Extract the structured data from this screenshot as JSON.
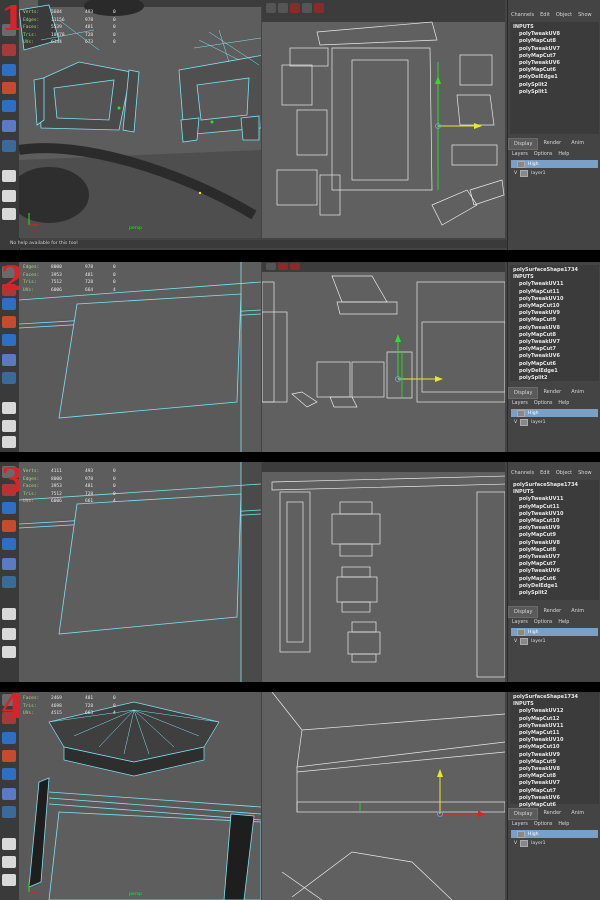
{
  "panels": [
    {
      "number": "1",
      "hud": [
        {
          "label": "Verts:",
          "a": "5684",
          "b": "493",
          "c": "0"
        },
        {
          "label": "Edges:",
          "a": "11156",
          "b": "978",
          "c": "0"
        },
        {
          "label": "Faces:",
          "a": "5539",
          "b": "481",
          "c": "0"
        },
        {
          "label": "Tris:",
          "a": "10478",
          "b": "728",
          "c": "0"
        },
        {
          "label": "UVs:",
          "a": "6144",
          "b": "673",
          "c": "0"
        }
      ],
      "tabs": [
        "Channels",
        "Edit",
        "Object",
        "Show"
      ],
      "node": "",
      "inputs_label": "INPUTS",
      "inputs": [
        "polyTweakUV8",
        "polyMapCut8",
        "polyTweakUV7",
        "polyMapCut7",
        "polyTweakUV6",
        "polyMapCut6",
        "polyDelEdge1",
        "polySplit2",
        "polySplit1"
      ],
      "camera": "persp",
      "status": "No help available for this tool"
    },
    {
      "number": "2",
      "hud": [
        {
          "label": "Edges:",
          "a": "8000",
          "b": "978",
          "c": "0"
        },
        {
          "label": "Faces:",
          "a": "3953",
          "b": "481",
          "c": "0"
        },
        {
          "label": "Tris:",
          "a": "7512",
          "b": "728",
          "c": "0"
        },
        {
          "label": "UVs:",
          "a": "6006",
          "b": "664",
          "c": "4"
        }
      ],
      "tabs": [],
      "node": "polySurfaceShape1734",
      "inputs_label": "INPUTS",
      "inputs": [
        "polyTweakUV11",
        "polyMapCut11",
        "polyTweakUV10",
        "polyMapCut10",
        "polyTweakUV9",
        "polyMapCut9",
        "polyTweakUV8",
        "polyMapCut8",
        "polyTweakUV7",
        "polyMapCut7",
        "polyTweakUV6",
        "polyMapCut6",
        "polyDelEdge1",
        "polySplit2"
      ],
      "camera": "",
      "status": ""
    },
    {
      "number": "3",
      "hud": [
        {
          "label": "Verts:",
          "a": "4111",
          "b": "493",
          "c": "0"
        },
        {
          "label": "Edges:",
          "a": "8000",
          "b": "978",
          "c": "0"
        },
        {
          "label": "Faces:",
          "a": "3953",
          "b": "481",
          "c": "0"
        },
        {
          "label": "Tris:",
          "a": "7512",
          "b": "728",
          "c": "0"
        },
        {
          "label": "UVs:",
          "a": "6006",
          "b": "661",
          "c": "4"
        }
      ],
      "tabs": [
        "Channels",
        "Edit",
        "Object",
        "Show"
      ],
      "node": "polySurfaceShape1734",
      "inputs_label": "INPUTS",
      "inputs": [
        "polyTweakUV11",
        "polyMapCut11",
        "polyTweakUV10",
        "polyMapCut10",
        "polyTweakUV9",
        "polyMapCut9",
        "polyTweakUV8",
        "polyMapCut8",
        "polyTweakUV7",
        "polyMapCut7",
        "polyTweakUV6",
        "polyMapCut6",
        "polyDelEdge1",
        "polySplit2"
      ],
      "camera": "",
      "status": ""
    },
    {
      "number": "4",
      "hud": [
        {
          "label": "Faces:",
          "a": "2469",
          "b": "481",
          "c": "0"
        },
        {
          "label": "Tris:",
          "a": "4698",
          "b": "728",
          "c": "0"
        },
        {
          "label": "UVs:",
          "a": "4515",
          "b": "663",
          "c": "4"
        }
      ],
      "tabs": [],
      "node": "polySurfaceShape1734",
      "inputs_label": "INPUTS",
      "inputs": [
        "polyTweakUV12",
        "polyMapCut12",
        "polyTweakUV11",
        "polyMapCut11",
        "polyTweakUV10",
        "polyMapCut10",
        "polyTweakUV9",
        "polyMapCut9",
        "polyTweakUV8",
        "polyMapCut8",
        "polyTweakUV7",
        "polyMapCut7",
        "polyTweakUV6",
        "polyMapCut6"
      ],
      "camera": "persp",
      "status": ""
    }
  ],
  "layer_editor": {
    "tabs": [
      "Display",
      "Render",
      "Anim"
    ],
    "menu": [
      "Layers",
      "Options",
      "Help"
    ],
    "rows": [
      {
        "flag": "",
        "name": "High",
        "selected": true
      },
      {
        "flag": "V",
        "name": "layer1",
        "selected": false
      }
    ]
  },
  "colors": {
    "wire": "#7fe3f0",
    "uv_line": "#e8e8e8",
    "move_y": "#e8e82a",
    "move_x": "#e8e82a",
    "move_x_red": "#e02020",
    "move_y_green": "#2ae02a",
    "number": "#d8232a",
    "selected_layer": "#7aa0c8"
  }
}
